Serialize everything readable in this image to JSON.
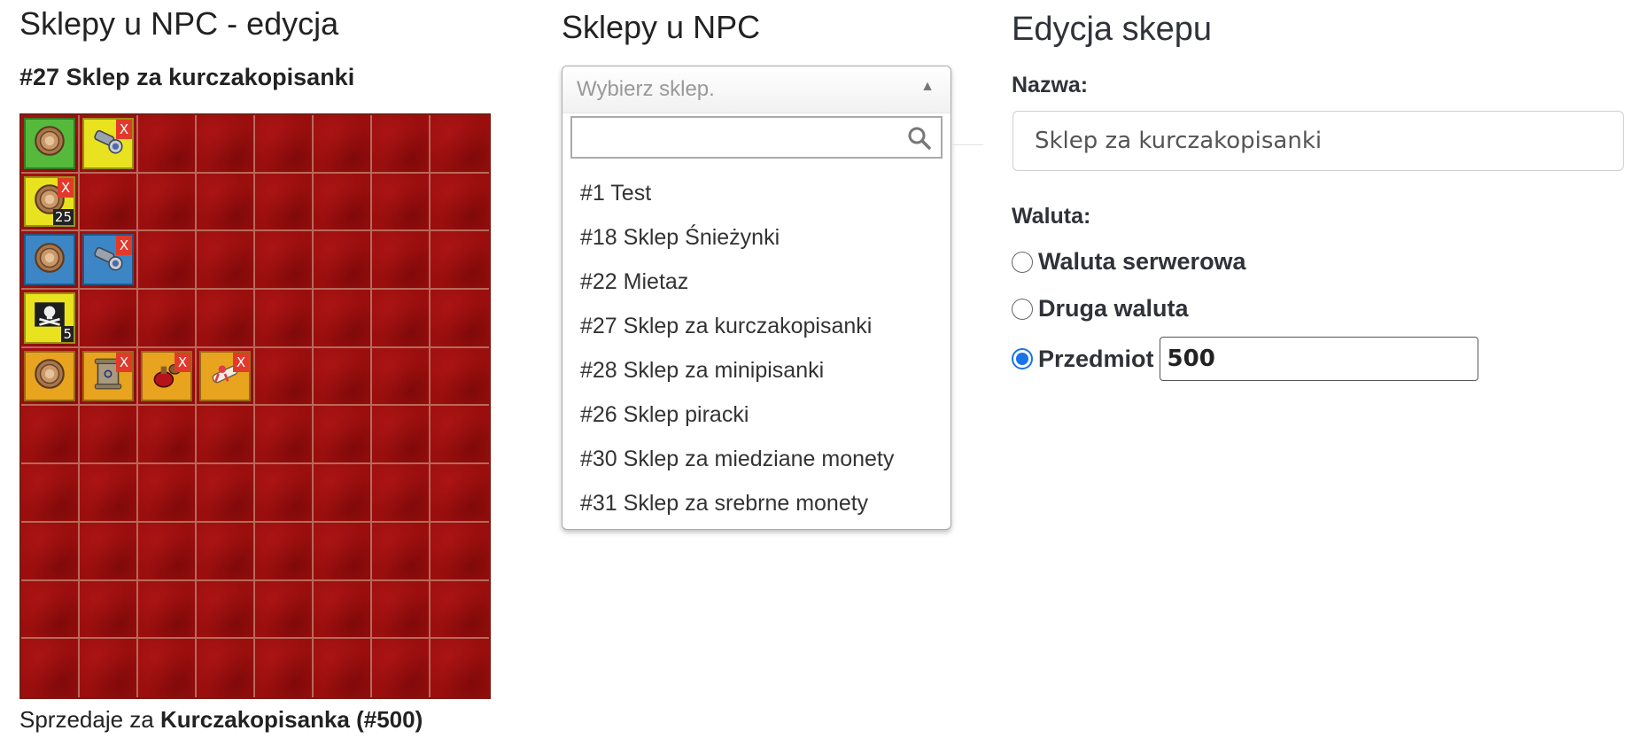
{
  "left": {
    "title": "Sklepy u NPC - edycja",
    "shop_heading": "#27 Sklep za kurczakopisanki",
    "grid": {
      "cols": 8,
      "rows": 10,
      "items": [
        {
          "row": 0,
          "col": 0,
          "bg": "green",
          "icon": "coin-icon"
        },
        {
          "row": 0,
          "col": 1,
          "bg": "yellow",
          "icon": "spyglass-icon",
          "removable": true
        },
        {
          "row": 1,
          "col": 0,
          "bg": "yellow",
          "icon": "coin-icon",
          "removable": true,
          "count": "25"
        },
        {
          "row": 2,
          "col": 0,
          "bg": "blue",
          "icon": "coin-icon"
        },
        {
          "row": 2,
          "col": 1,
          "bg": "blue",
          "icon": "spyglass-icon",
          "removable": true
        },
        {
          "row": 3,
          "col": 0,
          "bg": "yellow",
          "icon": "pirate-flag-icon",
          "count": "5"
        },
        {
          "row": 4,
          "col": 0,
          "bg": "orange",
          "icon": "coin-icon"
        },
        {
          "row": 4,
          "col": 1,
          "bg": "orange",
          "icon": "scroll-icon",
          "removable": true
        },
        {
          "row": 4,
          "col": 2,
          "bg": "orange",
          "icon": "potion-bag-icon",
          "removable": true
        },
        {
          "row": 4,
          "col": 3,
          "bg": "orange",
          "icon": "ribbon-scroll-icon",
          "removable": true
        }
      ],
      "remove_label": "X"
    },
    "footer_prefix": "Sprzedaje za",
    "footer_currency": "Kurczakopisanka (#500)"
  },
  "middle": {
    "title": "Sklepy u NPC",
    "select": {
      "placeholder": "Wybierz sklep.",
      "search_value": "",
      "options": [
        "#1 Test",
        "#18 Sklep Śnieżynki",
        "#22 Mietaz",
        "#27 Sklep za kurczakopisanki",
        "#28 Sklep za minipisanki",
        "#26 Sklep piracki",
        "#30 Sklep za miedziane monety",
        "#31 Sklep za srebrne monety"
      ]
    }
  },
  "right": {
    "title": "Edycja skepu",
    "name_label": "Nazwa:",
    "name_value": "Sklep za kurczakopisanki",
    "currency_label": "Waluta:",
    "currency_options": [
      {
        "label": "Waluta serwerowa",
        "checked": false
      },
      {
        "label": "Druga waluta",
        "checked": false
      },
      {
        "label": "Przedmiot",
        "checked": true
      }
    ],
    "item_id_value": "500"
  },
  "colors": {
    "grid_bg": "#9a0e0e",
    "slot_green": "#55b93c",
    "slot_yellow": "#e9e21f",
    "slot_blue": "#3c86c6",
    "slot_orange": "#e8a41e",
    "remove_red": "#e23a2a",
    "radio_blue": "#1a73e8"
  }
}
